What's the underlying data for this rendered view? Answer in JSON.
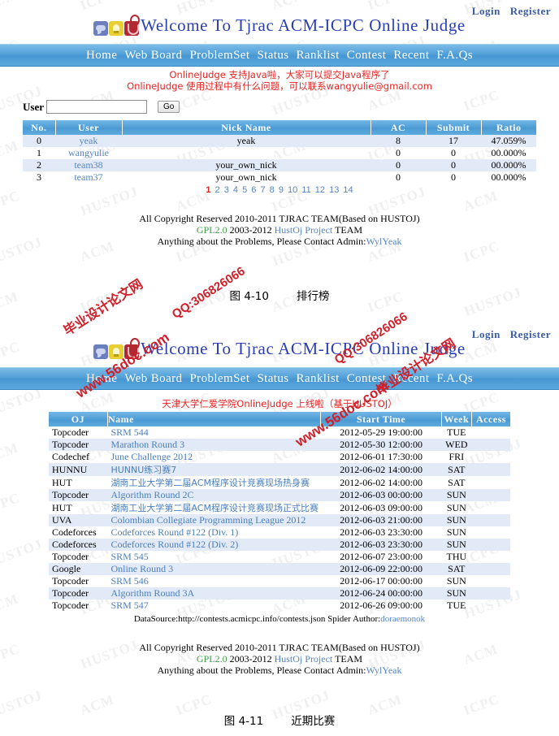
{
  "site": {
    "title": "Welcome To Tjrac ACM-ICPC Online Judge",
    "login": "Login",
    "register": "Register",
    "nav": [
      "Home",
      "Web Board",
      "ProblemSet",
      "Status",
      "Ranklist",
      "Contest",
      "Recent",
      "F.A.Qs"
    ],
    "icons": [
      "chat-bubble-icon",
      "lightbulb-icon",
      "flask-icon"
    ],
    "accent_blue": "#4f9ed6",
    "header_text_blue": "#2b3fb5",
    "link_blue": "#5584c4",
    "notice_red": "#ee2222",
    "row_alt_bg": "#e2eaf7"
  },
  "page1": {
    "notice": [
      "OnlineJudge 支持Java啦，大家可以提交Java程序了",
      "OnlineJudge 使用过程中有什么问题，可以联系wangyulie@gmail.com"
    ],
    "search": {
      "label": "User",
      "value": "",
      "placeholder": "",
      "button": "Go"
    },
    "table": {
      "headers": [
        "No.",
        "User",
        "Nick Name",
        "AC",
        "Submit",
        "Ratio"
      ],
      "rows": [
        {
          "no": "0",
          "user": "yeak",
          "nick": "yeak",
          "ac": "8",
          "submit": "17",
          "ratio": "47.059%"
        },
        {
          "no": "1",
          "user": "wangyulie",
          "nick": "",
          "ac": "0",
          "submit": "0",
          "ratio": "00.000%"
        },
        {
          "no": "2",
          "user": "team38",
          "nick": "your_own_nick",
          "ac": "0",
          "submit": "0",
          "ratio": "00.000%"
        },
        {
          "no": "3",
          "user": "team37",
          "nick": "your_own_nick",
          "ac": "0",
          "submit": "0",
          "ratio": "00.000%"
        }
      ]
    },
    "pagination": {
      "pages": [
        "1",
        "2",
        "3",
        "4",
        "5",
        "6",
        "7",
        "8",
        "9",
        "10",
        "11",
        "12",
        "13",
        "14"
      ],
      "current": "1"
    },
    "caption_num": "图 4-10",
    "caption_text": "排行榜"
  },
  "page2": {
    "notice": [
      "天津大学仁爱学院OnlineJudge 上线啦（基于HUSTOJ）"
    ],
    "table": {
      "headers": [
        "OJ",
        "Name",
        "Start Time",
        "Week",
        "Access"
      ],
      "rows": [
        {
          "oj": "Topcoder",
          "name": "SRM 544",
          "time": "2012-05-29 19:00:00",
          "week": "TUE",
          "access": ""
        },
        {
          "oj": "Topcoder",
          "name": "Marathon Round 3",
          "time": "2012-05-30 12:00:00",
          "week": "WED",
          "access": ""
        },
        {
          "oj": "Codechef",
          "name": "June Challenge 2012",
          "time": "2012-06-01 17:30:00",
          "week": "FRI",
          "access": ""
        },
        {
          "oj": "HUNNU",
          "name": "HUNNU练习赛7",
          "time": "2012-06-02 14:00:00",
          "week": "SAT",
          "access": ""
        },
        {
          "oj": "HUT",
          "name": "湖南工业大学第二届ACM程序设计竞赛现场热身赛",
          "time": "2012-06-02 14:00:00",
          "week": "SAT",
          "access": ""
        },
        {
          "oj": "Topcoder",
          "name": "Algorithm Round 2C",
          "time": "2012-06-03 00:00:00",
          "week": "SUN",
          "access": ""
        },
        {
          "oj": "HUT",
          "name": "湖南工业大学第二届ACM程序设计竞赛现场正式比赛",
          "time": "2012-06-03 09:00:00",
          "week": "SUN",
          "access": ""
        },
        {
          "oj": "UVA",
          "name": "Colombian Collegiate Programming League 2012",
          "time": "2012-06-03 21:00:00",
          "week": "SUN",
          "access": ""
        },
        {
          "oj": "Codeforces",
          "name": "Codeforces Round #122 (Div. 1)",
          "time": "2012-06-03 23:30:00",
          "week": "SUN",
          "access": ""
        },
        {
          "oj": "Codeforces",
          "name": "Codeforces Round #122 (Div. 2)",
          "time": "2012-06-03 23:30:00",
          "week": "SUN",
          "access": ""
        },
        {
          "oj": "Topcoder",
          "name": "SRM 545",
          "time": "2012-06-07 23:00:00",
          "week": "THU",
          "access": ""
        },
        {
          "oj": "Google",
          "name": "Online Round 3",
          "time": "2012-06-09 22:00:00",
          "week": "SAT",
          "access": ""
        },
        {
          "oj": "Topcoder",
          "name": "SRM 546",
          "time": "2012-06-17 00:00:00",
          "week": "SUN",
          "access": ""
        },
        {
          "oj": "Topcoder",
          "name": "Algorithm Round 3A",
          "time": "2012-06-24 00:00:00",
          "week": "SUN",
          "access": ""
        },
        {
          "oj": "Topcoder",
          "name": "SRM 547",
          "time": "2012-06-26 09:00:00",
          "week": "TUE",
          "access": ""
        }
      ]
    },
    "datasource_prefix": "DataSource:http://contests.acmicpc.info/contests.json Spider Author:",
    "datasource_author": "doraemonok",
    "caption_num": "图 4-11",
    "caption_text": "近期比赛"
  },
  "footer": {
    "line1": "All Copyright Reserved 2010-2011 TJRAC TEAM(Based on HUSTOJ)",
    "line2_gpl": "GPL2.0",
    "line2_years": "2003-2012",
    "line2_link": "HustOj Project",
    "line2_tail": "TEAM",
    "line3_prefix": "Anything about the Problems, Please Contact Admin:",
    "line3_link": "WylYeak"
  },
  "watermarks": {
    "tile_text": "ACM ICPC HUSTOJ",
    "red1": "毕业设计论文网",
    "red2": "www.56doc.com",
    "red3": "QQ:306826066"
  }
}
